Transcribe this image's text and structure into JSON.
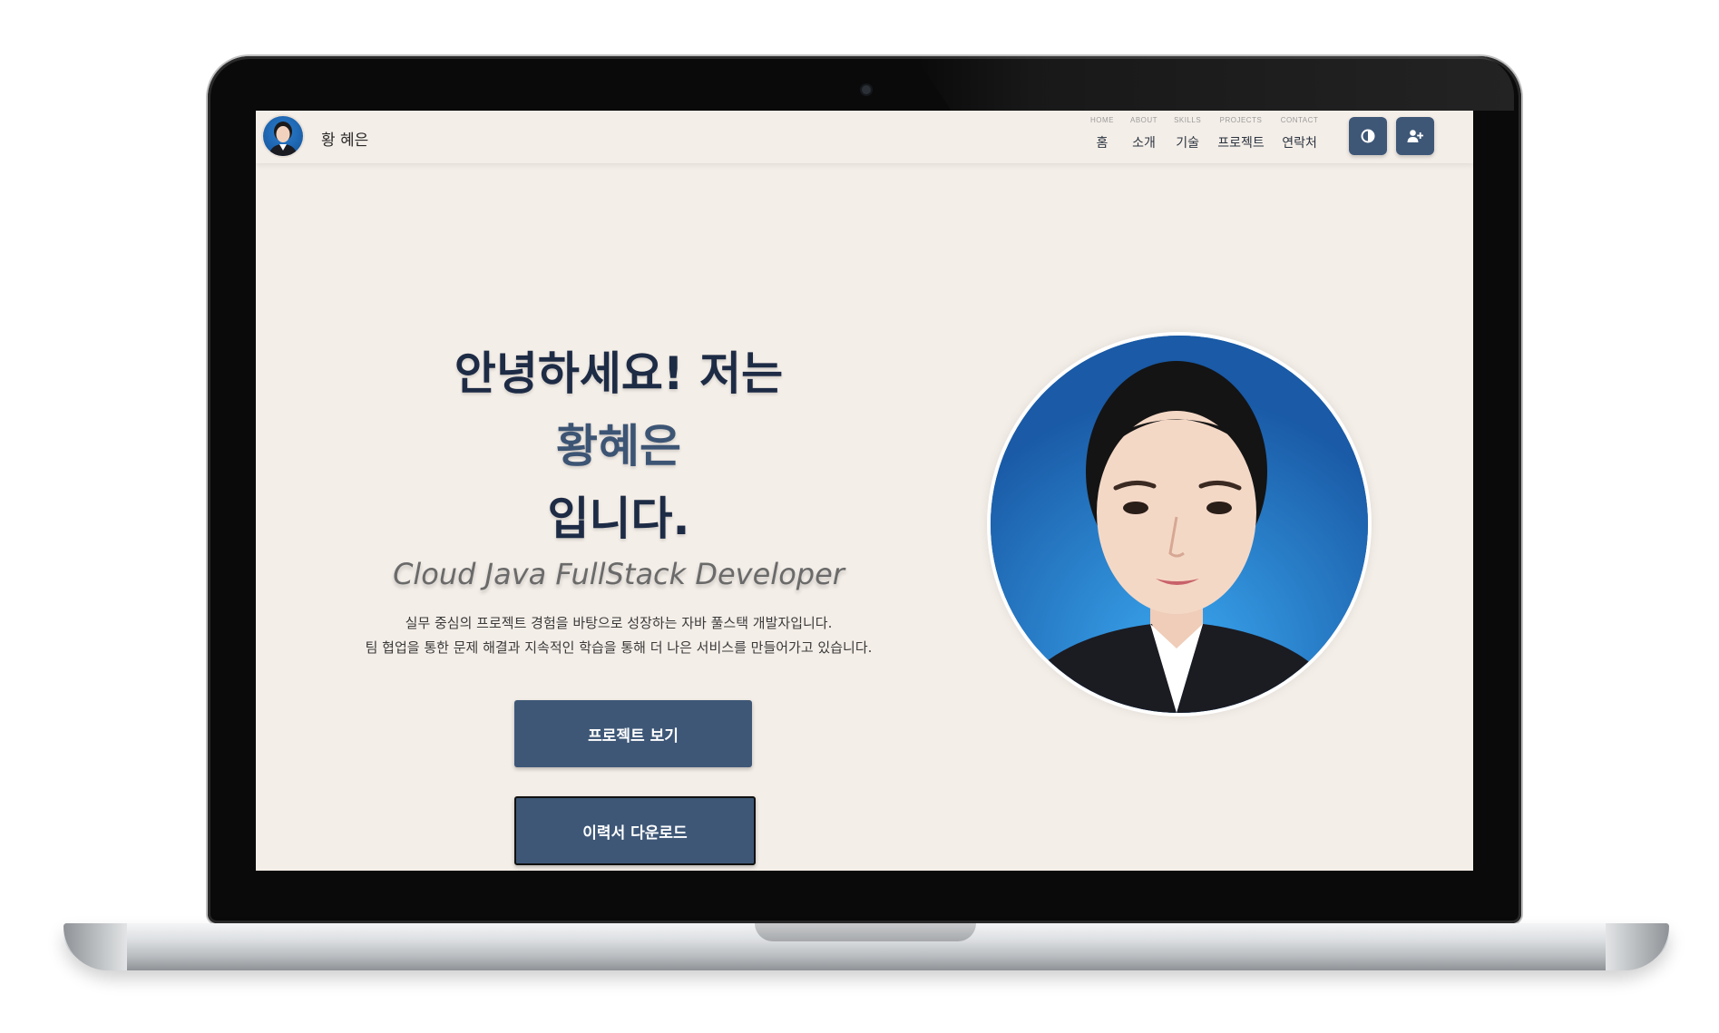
{
  "navbar": {
    "brand_name": "황 혜은",
    "items": [
      {
        "sub": "HOME",
        "label": "홈"
      },
      {
        "sub": "ABOUT",
        "label": "소개"
      },
      {
        "sub": "SKILLS",
        "label": "기술"
      },
      {
        "sub": "PROJECTS",
        "label": "프로젝트"
      },
      {
        "sub": "CONTACT",
        "label": "연락처"
      }
    ],
    "theme_toggle_icon": "contrast-icon",
    "add_contact_icon": "user-plus-icon"
  },
  "hero": {
    "line1": "안녕하세요! 저는",
    "name": "황혜은",
    "line3": "입니다.",
    "subtitle": "Cloud Java FullStack Developer",
    "desc1": "실무 중심의 프로젝트 경험을 바탕으로 성장하는 자바 풀스택 개발자입니다.",
    "desc2": "팀 협업을 통한 문제 해결과 지속적인 학습을 통해 더 나은 서비스를 만들어가고 있습니다.",
    "btn_projects": "프로젝트 보기",
    "btn_resume": "이력서 다운로드"
  },
  "colors": {
    "background": "#f4eee8",
    "accent": "#3e5777",
    "heading": "#1d2b45"
  }
}
